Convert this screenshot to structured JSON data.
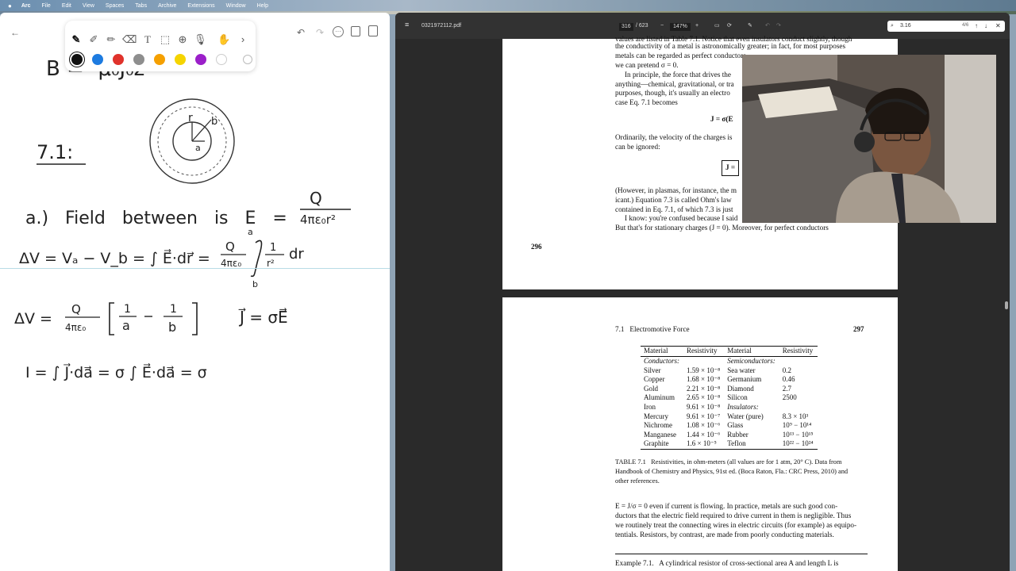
{
  "menubar": {
    "app_name": "Arc",
    "items": [
      "File",
      "Edit",
      "View",
      "Spaces",
      "Tabs",
      "Archive",
      "Extensions",
      "Window",
      "Help"
    ]
  },
  "notes": {
    "colors": [
      "#111111",
      "#1d7be0",
      "#e0322b",
      "#8e8e8e",
      "#f5a000",
      "#f5d400",
      "#9b1fc9",
      "#ffffff"
    ],
    "handwriting": {
      "top_partial": "B = -μ₀J₀ẑ",
      "problem": "7.1:",
      "part_a": "a.) Field between is E =",
      "frac_Q": "Q",
      "frac_den": "4πε₀r²",
      "dv_line1_left": "ΔV = Vₐ − V_b = ∫ E⃗·dr⃗ =",
      "dv_line1_coef_num": "Q",
      "dv_line1_coef_den": "4πε₀",
      "int_upper": "a",
      "int_lower": "b",
      "int_num": "1",
      "int_den": "r²",
      "int_dr": "dr",
      "dv_line2_left": "ΔV =",
      "dv_line2_num": "Q",
      "dv_line2_den": "4πε₀",
      "bracket_a_num": "1",
      "bracket_a_den": "a",
      "bracket_b_num": "1",
      "bracket_b_den": "b",
      "ohm": "J⃗ = σE⃗",
      "current": "I = ∫ J⃗·da⃗ = σ ∫ E⃗·da⃗ = σ",
      "diagram_r": "r",
      "diagram_b": "b",
      "diagram_a": "a"
    }
  },
  "pdf": {
    "filename": "0321972112.pdf",
    "page_current": "316",
    "page_total": "/ 623",
    "zoom": "147%",
    "search_value": "3.16",
    "search_count": "4/6",
    "page296": {
      "lines": [
        "values are listed in Table 7.1. Notice that even insulators conduct slightly, though",
        "the conductivity of a metal is astronomically greater; in fact, for most purposes",
        "metals can be regarded as perfect conductors",
        "we can pretend σ = 0.",
        "In principle, the force that drives the",
        "anything—chemical, gravitational, or tra",
        "purposes, though, it's usually an electro",
        "case Eq. 7.1 becomes",
        "J = σ(E",
        "Ordinarily, the velocity of the charges is",
        "can be ignored:",
        "J =",
        "(However, in plasmas, for instance, the m",
        "icant.) Equation 7.3 is called Ohm's law",
        "contained in Eq. 7.1, of which 7.3 is just",
        "I know: you're confused because I said",
        "But that's for stationary charges (J = 0). Moreover, for perfect conductors"
      ],
      "page_number": "296"
    },
    "page297": {
      "section": "7.1   Electromotive Force",
      "page_number": "297",
      "table_headers": [
        "Material",
        "Resistivity",
        "Material",
        "Resistivity"
      ],
      "table_rows": [
        [
          "Conductors:",
          "",
          "Semiconductors:",
          ""
        ],
        [
          "Silver",
          "1.59 × 10⁻⁸",
          "Sea water",
          "0.2"
        ],
        [
          "Copper",
          "1.68 × 10⁻⁸",
          "Germanium",
          "0.46"
        ],
        [
          "Gold",
          "2.21 × 10⁻⁸",
          "Diamond",
          "2.7"
        ],
        [
          "Aluminum",
          "2.65 × 10⁻⁸",
          "Silicon",
          "2500"
        ],
        [
          "Iron",
          "9.61 × 10⁻⁸",
          "Insulators:",
          ""
        ],
        [
          "Mercury",
          "9.61 × 10⁻⁷",
          "Water (pure)",
          "8.3 × 10³"
        ],
        [
          "Nichrome",
          "1.08 × 10⁻⁶",
          "Glass",
          "10⁹ − 10¹⁴"
        ],
        [
          "Manganese",
          "1.44 × 10⁻⁶",
          "Rubber",
          "10¹³ − 10¹⁵"
        ],
        [
          "Graphite",
          "1.6 × 10⁻⁵",
          "Teflon",
          "10²² − 10²⁴"
        ]
      ],
      "caption_lines": [
        "TABLE 7.1   Resistivities, in ohm-meters (all values are for 1 atm, 20° C). Data from",
        "Handbook of Chemistry and Physics, 91st ed. (Boca Raton, Fla.: CRC Press, 2010) and",
        "other references."
      ],
      "body_lines": [
        "E = J/σ = 0 even if current is flowing. In practice, metals are such good con-",
        "ductors that the electric field required to drive current in them is negligible. Thus",
        "we routinely treat the connecting wires in electric circuits (for example) as equipo-",
        "tentials. Resistors, by contrast, are made from poorly conducting materials."
      ],
      "example": "Example 7.1.   A cylindrical resistor of cross-sectional area A and length L is"
    }
  }
}
